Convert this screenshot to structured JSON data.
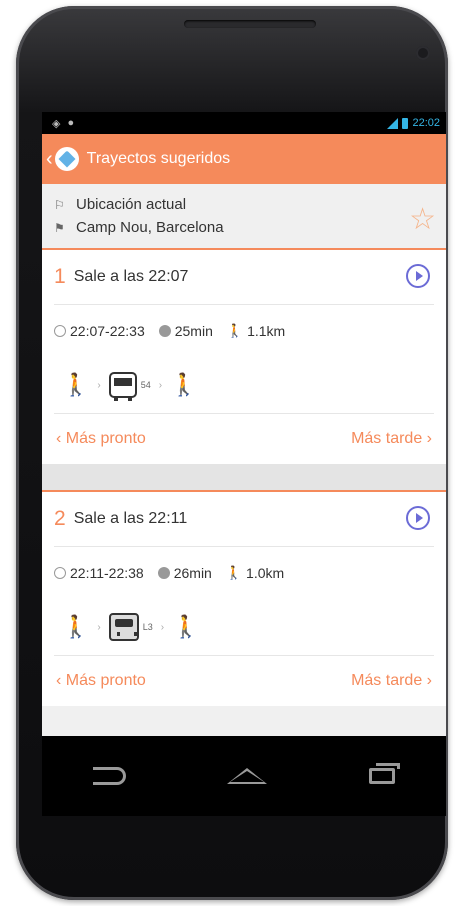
{
  "status": {
    "time": "22:02"
  },
  "appbar": {
    "title": "Trayectos sugeridos"
  },
  "route": {
    "origin": "Ubicación actual",
    "destination": "Camp Nou, Barcelona"
  },
  "trips": [
    {
      "number": "1",
      "title": "Sale a las 22:07",
      "time_range": "22:07-22:33",
      "duration": "25min",
      "walk_distance": "1.1km",
      "line": "54",
      "mode": "bus",
      "earlier": "Más pronto",
      "later": "Más tarde"
    },
    {
      "number": "2",
      "title": "Sale a las 22:11",
      "time_range": "22:11-22:38",
      "duration": "26min",
      "walk_distance": "1.0km",
      "line": "L3",
      "mode": "metro",
      "earlier": "Más pronto",
      "later": "Más tarde"
    }
  ],
  "colors": {
    "accent": "#f58a5b",
    "play": "#6b6bd6",
    "statusbar_accent": "#34b5e5"
  }
}
